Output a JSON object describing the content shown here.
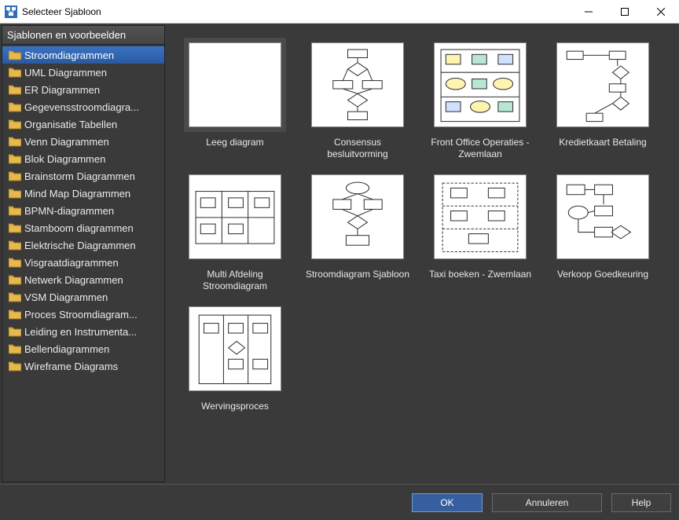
{
  "window": {
    "title": "Selecteer Sjabloon"
  },
  "sidebar": {
    "header": "Sjablonen en voorbeelden",
    "items": [
      {
        "label": "Stroomdiagrammen",
        "selected": true
      },
      {
        "label": "UML Diagrammen"
      },
      {
        "label": "ER Diagrammen"
      },
      {
        "label": "Gegevensstroomdiagra..."
      },
      {
        "label": "Organisatie Tabellen"
      },
      {
        "label": "Venn Diagrammen"
      },
      {
        "label": "Blok Diagrammen"
      },
      {
        "label": "Brainstorm Diagrammen"
      },
      {
        "label": "Mind Map Diagrammen"
      },
      {
        "label": "BPMN-diagrammen"
      },
      {
        "label": "Stamboom diagrammen"
      },
      {
        "label": "Elektrische Diagrammen"
      },
      {
        "label": "Visgraatdiagrammen"
      },
      {
        "label": "Netwerk Diagrammen"
      },
      {
        "label": "VSM Diagrammen"
      },
      {
        "label": "Proces Stroomdiagram..."
      },
      {
        "label": "Leiding en Instrumenta..."
      },
      {
        "label": "Bellendiagrammen"
      },
      {
        "label": " Wireframe Diagrams"
      }
    ]
  },
  "templates": [
    {
      "label": "Leeg diagram",
      "thumb": "blank",
      "selected": true
    },
    {
      "label": "Consensus besluitvorming",
      "thumb": "flow1"
    },
    {
      "label": "Front Office Operaties - Zwemlaan",
      "thumb": "swim-color"
    },
    {
      "label": "Kredietkaart Betaling",
      "thumb": "flow2"
    },
    {
      "label": "Multi Afdeling Stroomdiagram",
      "thumb": "multi"
    },
    {
      "label": "Stroomdiagram Sjabloon",
      "thumb": "flow3"
    },
    {
      "label": "Taxi boeken - Zwemlaan",
      "thumb": "swim-dash"
    },
    {
      "label": "Verkoop Goedkeuring",
      "thumb": "flow4"
    },
    {
      "label": "Wervingsproces",
      "thumb": "swim-v"
    }
  ],
  "footer": {
    "ok": "OK",
    "cancel": "Annuleren",
    "help": "Help"
  }
}
